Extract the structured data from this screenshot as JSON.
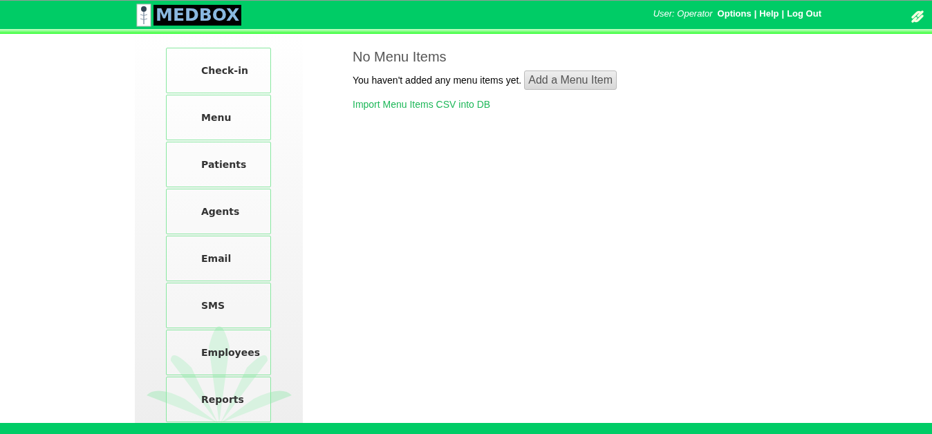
{
  "header": {
    "logo": "MEDBOX",
    "user": "User: Operator",
    "links": [
      "Options",
      "Help",
      "Log Out"
    ],
    "separator": "|"
  },
  "sidebar": {
    "items": [
      {
        "label": "Check-in"
      },
      {
        "label": "Menu"
      },
      {
        "label": "Patients"
      },
      {
        "label": "Agents"
      },
      {
        "label": "Email"
      },
      {
        "label": "SMS"
      },
      {
        "label": "Employees"
      },
      {
        "label": "Reports"
      }
    ]
  },
  "content": {
    "heading": "No Menu Items",
    "message": "You haven't added any menu items yet.",
    "add_button": "Add a Menu Item",
    "import_link": "Import Menu Items CSV into DB"
  }
}
